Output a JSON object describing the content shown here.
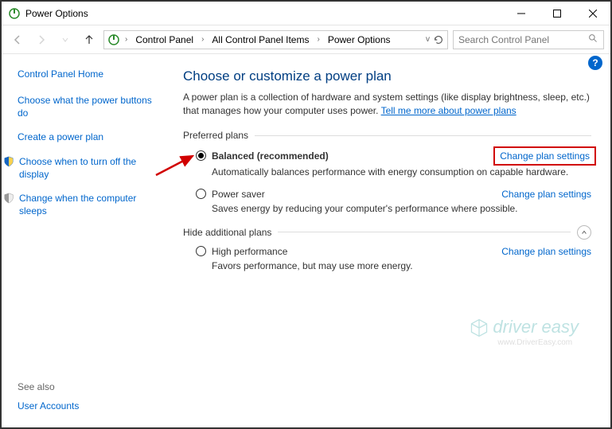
{
  "window": {
    "title": "Power Options"
  },
  "breadcrumb": {
    "items": [
      "Control Panel",
      "All Control Panel Items",
      "Power Options"
    ]
  },
  "search": {
    "placeholder": "Search Control Panel"
  },
  "sidebar": {
    "home": "Control Panel Home",
    "links": [
      "Choose what the power buttons do",
      "Create a power plan",
      "Choose when to turn off the display",
      "Change when the computer sleeps"
    ],
    "seealso_hdr": "See also",
    "seealso_link": "User Accounts"
  },
  "main": {
    "heading": "Choose or customize a power plan",
    "desc_pre": "A power plan is a collection of hardware and system settings (like display brightness, sleep, etc.) that manages how your computer uses power. ",
    "desc_link": "Tell me more about power plans",
    "pref_hdr": "Preferred plans",
    "hide_hdr": "Hide additional plans",
    "change_label": "Change plan settings",
    "plans": {
      "balanced": {
        "name": "Balanced (recommended)",
        "desc": "Automatically balances performance with energy consumption on capable hardware."
      },
      "saver": {
        "name": "Power saver",
        "desc": "Saves energy by reducing your computer's performance where possible."
      },
      "high": {
        "name": "High performance",
        "desc": "Favors performance, but may use more energy."
      }
    }
  },
  "watermark": {
    "brand": "driver easy",
    "url": "www.DriverEasy.com"
  }
}
